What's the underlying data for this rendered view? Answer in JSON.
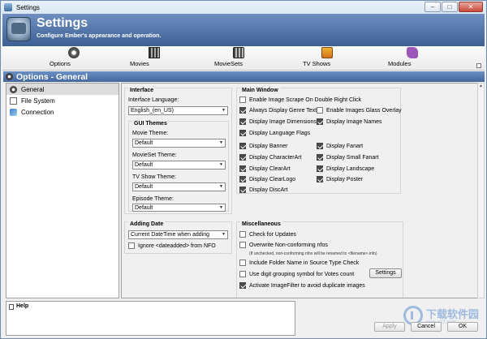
{
  "window": {
    "title": "Settings"
  },
  "header": {
    "title": "Settings",
    "subtitle": "Configure Ember's appearance and operation."
  },
  "toolbar": {
    "items": [
      {
        "label": "Options",
        "icon": "gear-icon"
      },
      {
        "label": "Movies",
        "icon": "film-icon"
      },
      {
        "label": "MovieSets",
        "icon": "movieset-icon"
      },
      {
        "label": "TV Shows",
        "icon": "tv-icon"
      },
      {
        "label": "Modules",
        "icon": "puzzle-icon"
      }
    ]
  },
  "section_title": "Options - General",
  "nav": {
    "items": [
      {
        "label": "General",
        "icon": "gear-icon",
        "selected": true
      },
      {
        "label": "File System",
        "icon": "file-icon",
        "selected": false
      },
      {
        "label": "Connection",
        "icon": "connection-icon",
        "selected": false
      }
    ]
  },
  "interface": {
    "title": "Interface",
    "language_label": "Interface Language:",
    "language_value": "English_(en_US)",
    "gui_themes": {
      "title": "GUI Themes",
      "movie_label": "Movie Theme:",
      "movie_value": "Default",
      "movieset_label": "MovieSet Theme:",
      "movieset_value": "Default",
      "tvshow_label": "TV Show Theme:",
      "tvshow_value": "Default",
      "episode_label": "Episode Theme:",
      "episode_value": "Default"
    }
  },
  "adding_date": {
    "title": "Adding Date",
    "value": "Current DateTime when adding",
    "ignore_label": "Ignore <dateadded> from NFO",
    "ignore_checked": false
  },
  "main_window": {
    "title": "Main Window",
    "enable_scrape": {
      "label": "Enable Image Scrape On Double Right Click",
      "checked": false
    },
    "left": [
      {
        "label": "Always Display Genre Text",
        "checked": true
      },
      {
        "label": "Display Image Dimensions",
        "checked": true
      },
      {
        "label": "Display Language Flags",
        "checked": true
      },
      {
        "label": "Display Banner",
        "checked": true
      },
      {
        "label": "Display CharacterArt",
        "checked": true
      },
      {
        "label": "Display ClearArt",
        "checked": true
      },
      {
        "label": "Display ClearLogo",
        "checked": true
      },
      {
        "label": "Display DiscArt",
        "checked": true
      }
    ],
    "right_top": [
      {
        "label": "Enable Images Glass Overlay",
        "checked": false
      },
      {
        "label": "Display Image Names",
        "checked": true
      }
    ],
    "right_bottom": [
      {
        "label": "Display Fanart",
        "checked": true
      },
      {
        "label": "Display Small Fanart",
        "checked": true
      },
      {
        "label": "Display Landscape",
        "checked": true
      },
      {
        "label": "Display Poster",
        "checked": true
      }
    ]
  },
  "misc": {
    "title": "Miscellaneous",
    "check_updates": {
      "label": "Check for Updates",
      "checked": false
    },
    "overwrite_nfo": {
      "label": "Overwrite Non-conforming nfos",
      "checked": false
    },
    "overwrite_note": "(If unchecked, non-conforming nfos will be renamed to <filename>.info)",
    "folder_name": {
      "label": "Include Folder Name in Source Type Check",
      "checked": false
    },
    "digit_grouping": {
      "label": "Use digit grouping symbol for Votes count",
      "checked": false
    },
    "settings_button": "Settings",
    "image_filter": {
      "label": "Activate ImageFilter to avoid duplicate images",
      "checked": true
    }
  },
  "help": {
    "title": "Help"
  },
  "buttons": {
    "apply": "Apply",
    "cancel": "Cancel",
    "ok": "OK"
  },
  "watermark": {
    "text": "下载软件园",
    "url": "www.xz7.com"
  }
}
